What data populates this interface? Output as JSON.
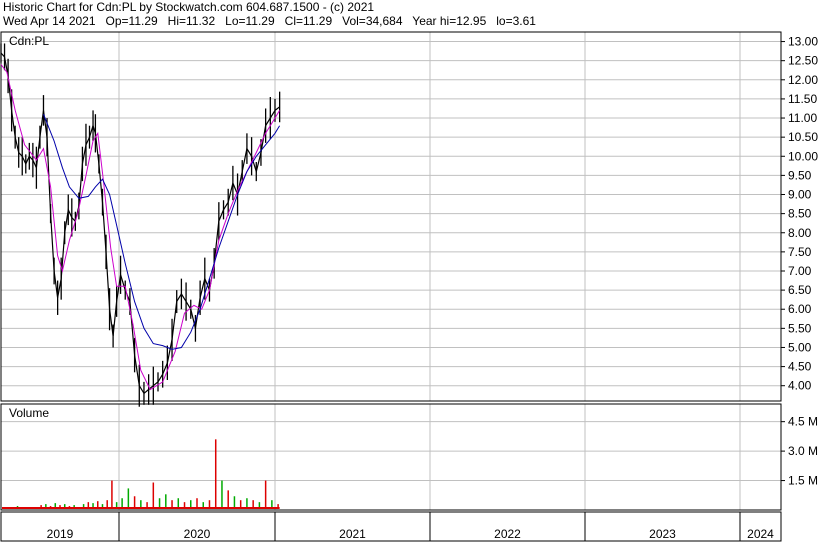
{
  "header": {
    "line1": "Historic Chart for Cdn:PL by Stockwatch.com 604.687.1500 - (c) 2021",
    "line2": "Wed Apr 14 2021   Op=11.29   Hi=11.32   Lo=11.29   Cl=11.29   Vol=34,684   Year hi=12.95   lo=3.61"
  },
  "colors": {
    "price": "#000000",
    "ma_short": "#cc00cc",
    "ma_long": "#0000aa",
    "volume_up": "#00aa00",
    "volume_down": "#dd0000",
    "grid": "#c0c0c0"
  },
  "chart_data": [
    {
      "type": "line",
      "panel_label": "Cdn:PL",
      "x_axis": {
        "labels": [
          "2019",
          "2020",
          "2021",
          "2022",
          "2023",
          "2024"
        ]
      },
      "y_axis": {
        "ticks": [
          "13.00",
          "12.50",
          "12.00",
          "11.50",
          "11.00",
          "10.50",
          "10.00",
          "9.50",
          "9.00",
          "8.50",
          "8.00",
          "7.50",
          "7.00",
          "6.50",
          "6.00",
          "5.50",
          "5.00",
          "4.50",
          "4.00"
        ],
        "ylim": [
          3.6,
          13.25
        ]
      },
      "grid": true,
      "series": [
        {
          "kind": "price",
          "points": [
            [
              0,
              12.7
            ],
            [
              0.03,
              12.6
            ],
            [
              0.06,
              12.1
            ],
            [
              0.09,
              11.2
            ],
            [
              0.12,
              10.5
            ],
            [
              0.15,
              10.1
            ],
            [
              0.18,
              10.0
            ],
            [
              0.21,
              9.8
            ],
            [
              0.24,
              10.0
            ],
            [
              0.27,
              9.9
            ],
            [
              0.3,
              9.7
            ],
            [
              0.33,
              10.5
            ],
            [
              0.36,
              11.2
            ],
            [
              0.39,
              10.5
            ],
            [
              0.42,
              8.5
            ],
            [
              0.45,
              7.0
            ],
            [
              0.48,
              6.3
            ],
            [
              0.51,
              6.8
            ],
            [
              0.54,
              8.0
            ],
            [
              0.57,
              8.6
            ],
            [
              0.6,
              8.4
            ],
            [
              0.63,
              8.3
            ],
            [
              0.66,
              8.7
            ],
            [
              0.69,
              9.8
            ],
            [
              0.72,
              10.3
            ],
            [
              0.75,
              10.5
            ],
            [
              0.78,
              10.8
            ],
            [
              0.8,
              10.6
            ],
            [
              0.83,
              9.8
            ],
            [
              0.86,
              8.8
            ],
            [
              0.89,
              7.5
            ],
            [
              0.92,
              6.0
            ],
            [
              0.95,
              5.3
            ],
            [
              0.98,
              6.2
            ],
            [
              1.01,
              6.9
            ],
            [
              1.04,
              6.5
            ],
            [
              1.07,
              6.2
            ],
            [
              1.1,
              4.8
            ],
            [
              1.13,
              4.0
            ],
            [
              1.16,
              3.8
            ],
            [
              1.19,
              3.9
            ],
            [
              1.22,
              4.0
            ],
            [
              1.25,
              4.1
            ],
            [
              1.28,
              4.3
            ],
            [
              1.31,
              4.6
            ],
            [
              1.34,
              5.2
            ],
            [
              1.37,
              6.2
            ],
            [
              1.4,
              6.4
            ],
            [
              1.43,
              6.2
            ],
            [
              1.46,
              6.0
            ],
            [
              1.49,
              5.5
            ],
            [
              1.52,
              6.3
            ],
            [
              1.55,
              6.8
            ],
            [
              1.58,
              6.5
            ],
            [
              1.61,
              7.2
            ],
            [
              1.64,
              8.3
            ],
            [
              1.67,
              8.6
            ],
            [
              1.7,
              8.8
            ],
            [
              1.73,
              9.3
            ],
            [
              1.76,
              9.0
            ],
            [
              1.79,
              9.6
            ],
            [
              1.82,
              10.2
            ],
            [
              1.85,
              10.0
            ],
            [
              1.88,
              9.6
            ],
            [
              1.91,
              10.1
            ],
            [
              1.94,
              10.8
            ],
            [
              1.97,
              11.0
            ],
            [
              2.0,
              11.2
            ],
            [
              2.03,
              11.29
            ]
          ]
        },
        {
          "kind": "ma_short",
          "points": [
            [
              0,
              12.4
            ],
            [
              0.05,
              12.2
            ],
            [
              0.12,
              11.2
            ],
            [
              0.2,
              10.3
            ],
            [
              0.3,
              9.9
            ],
            [
              0.36,
              10.2
            ],
            [
              0.42,
              9.2
            ],
            [
              0.48,
              7.4
            ],
            [
              0.52,
              7.0
            ],
            [
              0.58,
              7.8
            ],
            [
              0.65,
              8.5
            ],
            [
              0.72,
              9.5
            ],
            [
              0.78,
              10.4
            ],
            [
              0.82,
              10.6
            ],
            [
              0.87,
              9.3
            ],
            [
              0.93,
              7.6
            ],
            [
              0.98,
              6.6
            ],
            [
              1.04,
              6.6
            ],
            [
              1.09,
              5.6
            ],
            [
              1.14,
              4.4
            ],
            [
              1.2,
              3.9
            ],
            [
              1.28,
              4.1
            ],
            [
              1.36,
              4.9
            ],
            [
              1.42,
              5.9
            ],
            [
              1.48,
              6.1
            ],
            [
              1.53,
              6.0
            ],
            [
              1.58,
              6.5
            ],
            [
              1.64,
              7.8
            ],
            [
              1.7,
              8.5
            ],
            [
              1.76,
              9.1
            ],
            [
              1.82,
              9.6
            ],
            [
              1.88,
              10.1
            ],
            [
              1.94,
              10.6
            ],
            [
              2.0,
              11.0
            ],
            [
              2.03,
              11.2
            ]
          ]
        },
        {
          "kind": "ma_long",
          "points": [
            [
              0.36,
              11.1
            ],
            [
              0.45,
              10.4
            ],
            [
              0.52,
              9.7
            ],
            [
              0.58,
              9.2
            ],
            [
              0.66,
              8.9
            ],
            [
              0.74,
              8.95
            ],
            [
              0.8,
              9.2
            ],
            [
              0.86,
              9.4
            ],
            [
              0.92,
              9.0
            ],
            [
              0.98,
              8.2
            ],
            [
              1.04,
              7.2
            ],
            [
              1.1,
              6.2
            ],
            [
              1.16,
              5.5
            ],
            [
              1.22,
              5.1
            ],
            [
              1.28,
              5.05
            ],
            [
              1.34,
              4.95
            ],
            [
              1.4,
              5.0
            ],
            [
              1.46,
              5.4
            ],
            [
              1.52,
              6.0
            ],
            [
              1.58,
              6.8
            ],
            [
              1.64,
              7.6
            ],
            [
              1.7,
              8.3
            ],
            [
              1.76,
              9.0
            ],
            [
              1.82,
              9.6
            ],
            [
              1.88,
              10.0
            ],
            [
              1.94,
              10.3
            ],
            [
              2.0,
              10.6
            ],
            [
              2.03,
              10.8
            ]
          ]
        }
      ]
    },
    {
      "type": "bar",
      "panel_label": "Volume",
      "y_axis": {
        "ticks": [
          "4.5 M",
          "3.0 M",
          "1.5 M"
        ],
        "ylim": [
          0,
          5.4
        ]
      },
      "x_axis": {
        "labels": [
          "2019",
          "2020",
          "2021",
          "2022",
          "2023",
          "2024"
        ]
      },
      "bars": [
        [
          0.02,
          0.1,
          "d"
        ],
        [
          0.06,
          0.15,
          "u"
        ],
        [
          0.1,
          0.12,
          "d"
        ],
        [
          0.14,
          0.2,
          "u"
        ],
        [
          0.18,
          0.1,
          "d"
        ],
        [
          0.22,
          0.12,
          "u"
        ],
        [
          0.26,
          0.15,
          "d"
        ],
        [
          0.3,
          0.1,
          "u"
        ],
        [
          0.34,
          0.25,
          "d"
        ],
        [
          0.38,
          0.3,
          "u"
        ],
        [
          0.42,
          0.2,
          "d"
        ],
        [
          0.46,
          0.35,
          "u"
        ],
        [
          0.5,
          0.25,
          "d"
        ],
        [
          0.54,
          0.3,
          "u"
        ],
        [
          0.58,
          0.2,
          "d"
        ],
        [
          0.62,
          0.25,
          "u"
        ],
        [
          0.66,
          0.15,
          "d"
        ],
        [
          0.7,
          0.3,
          "u"
        ],
        [
          0.74,
          0.4,
          "d"
        ],
        [
          0.78,
          0.35,
          "u"
        ],
        [
          0.82,
          0.45,
          "d"
        ],
        [
          0.86,
          0.3,
          "u"
        ],
        [
          0.9,
          0.5,
          "d"
        ],
        [
          0.94,
          1.5,
          "d"
        ],
        [
          0.98,
          0.4,
          "u"
        ],
        [
          1.02,
          0.6,
          "u"
        ],
        [
          1.06,
          1.1,
          "u"
        ],
        [
          1.1,
          0.7,
          "d"
        ],
        [
          1.14,
          0.5,
          "u"
        ],
        [
          1.18,
          0.4,
          "d"
        ],
        [
          1.22,
          1.4,
          "d"
        ],
        [
          1.26,
          0.6,
          "u"
        ],
        [
          1.3,
          0.8,
          "u"
        ],
        [
          1.34,
          0.5,
          "d"
        ],
        [
          1.38,
          0.6,
          "u"
        ],
        [
          1.42,
          0.4,
          "d"
        ],
        [
          1.46,
          0.5,
          "u"
        ],
        [
          1.5,
          0.6,
          "d"
        ],
        [
          1.54,
          0.4,
          "u"
        ],
        [
          1.58,
          0.5,
          "d"
        ],
        [
          1.62,
          3.6,
          "d"
        ],
        [
          1.66,
          1.5,
          "u"
        ],
        [
          1.7,
          1.0,
          "d"
        ],
        [
          1.74,
          0.7,
          "u"
        ],
        [
          1.78,
          0.5,
          "d"
        ],
        [
          1.82,
          0.6,
          "u"
        ],
        [
          1.86,
          0.5,
          "d"
        ],
        [
          1.9,
          0.4,
          "u"
        ],
        [
          1.94,
          1.5,
          "d"
        ],
        [
          1.98,
          0.5,
          "u"
        ],
        [
          2.02,
          0.3,
          "d"
        ]
      ]
    }
  ]
}
